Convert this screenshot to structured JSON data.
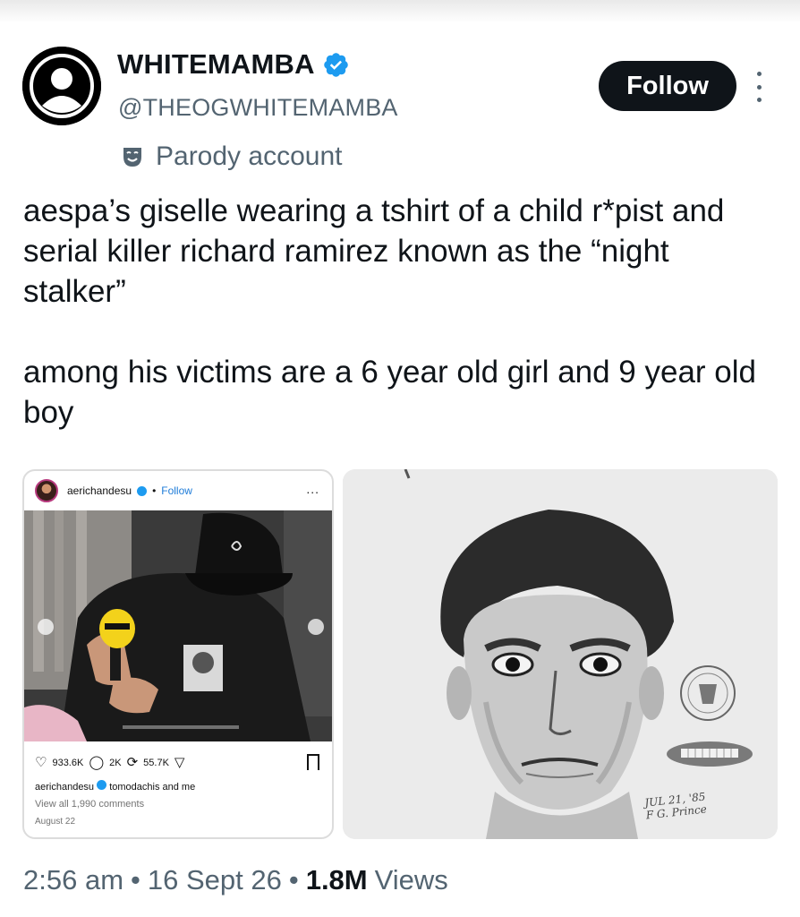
{
  "author": {
    "display_name": "WHITEMAMBA",
    "handle": "@THEOGWHITEMAMBA",
    "verified_icon": "verified-badge-icon",
    "follow_label": "Follow",
    "more_icon": "more-vertical-icon",
    "parody_label": "Parody account",
    "parody_icon": "parody-mask-icon"
  },
  "tweet": {
    "paragraphs": [
      "aespa’s giselle wearing a tshirt of a child r*pist and serial killer richard ramirez known as the “night stalker”",
      "among his victims are a 6 year old girl and 9 year old boy"
    ]
  },
  "instagram_card": {
    "username": "aerichandesu",
    "separator": "•",
    "follow_label": "Follow",
    "more": "...",
    "likes": "933.6K",
    "comments_count": "2K",
    "shares": "55.7K",
    "caption_user": "aerichandesu",
    "caption_text": "tomodachis and me",
    "view_comments": "View all 1,990 comments",
    "date": "August 22"
  },
  "sketch": {
    "signature_line1": "JUL 21, '85",
    "signature_line2": "F G. Prince"
  },
  "footer": {
    "time": "2:56 am",
    "sep1": "•",
    "date": "16 Sept 26",
    "sep2": "•",
    "views_count": "1.8M",
    "views_label": "Views"
  },
  "colors": {
    "text_primary": "#0f1419",
    "text_secondary": "#536471",
    "verified_blue": "#1d9bf0",
    "button_bg": "#0f1419"
  }
}
